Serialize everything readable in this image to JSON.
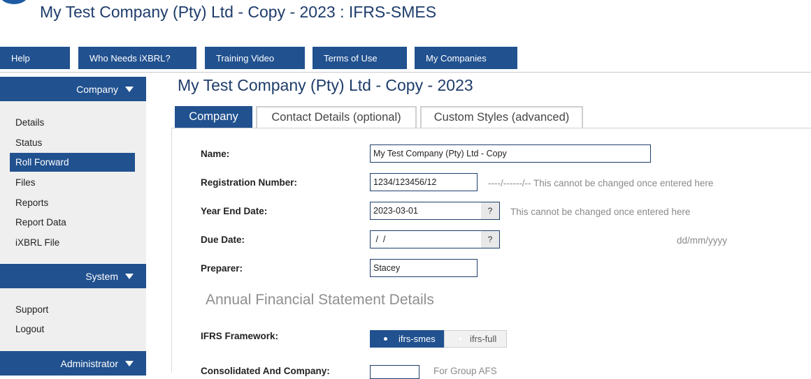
{
  "app": {
    "title": "My Test Company (Pty) Ltd - Copy - 2023 : IFRS-SMES"
  },
  "topnav": [
    {
      "label": "Help"
    },
    {
      "label": "Who Needs iXBRL?"
    },
    {
      "label": "Training Video"
    },
    {
      "label": "Terms of Use"
    },
    {
      "label": "My Companies"
    }
  ],
  "sidebar": {
    "company": {
      "heading": "Company",
      "items": [
        {
          "label": "Details"
        },
        {
          "label": "Status"
        },
        {
          "label": "Roll Forward"
        },
        {
          "label": "Files"
        },
        {
          "label": "Reports"
        },
        {
          "label": "Report Data"
        },
        {
          "label": "iXBRL File"
        }
      ],
      "active": "Roll Forward"
    },
    "system": {
      "heading": "System",
      "items": [
        {
          "label": "Support"
        },
        {
          "label": "Logout"
        }
      ]
    },
    "administrator": {
      "heading": "Administrator"
    }
  },
  "main": {
    "title": "My Test Company (Pty) Ltd - Copy - 2023",
    "tabs": [
      {
        "label": "Company"
      },
      {
        "label": "Contact Details (optional)"
      },
      {
        "label": "Custom Styles (advanced)"
      }
    ],
    "active_tab": "Company",
    "form": {
      "name": {
        "label": "Name:",
        "value": "My Test Company (Pty) Ltd - Copy"
      },
      "registration": {
        "label": "Registration Number:",
        "value": "1234/123456/12",
        "hint": "----/------/-- This cannot be changed once entered here"
      },
      "year_end": {
        "label": "Year End Date:",
        "value": "2023-03-01",
        "help": "?",
        "hint": "This cannot be changed once entered here"
      },
      "due_date": {
        "label": "Due Date:",
        "value": " /  /",
        "help": "?",
        "hint": "dd/mm/yyyy"
      },
      "preparer": {
        "label": "Preparer:",
        "value": "Stacey"
      }
    },
    "afs_section": {
      "title": "Annual Financial Statement Details",
      "framework": {
        "label": "IFRS Framework:",
        "options": [
          "ifrs-smes",
          "ifrs-full"
        ],
        "selected": "ifrs-smes"
      },
      "consolidated": {
        "label": "Consolidated And Company:",
        "hint": "For Group AFS"
      }
    }
  },
  "colors": {
    "accent": "#21518f",
    "title": "#1e3d6b",
    "hint": "#8a8a8a"
  }
}
